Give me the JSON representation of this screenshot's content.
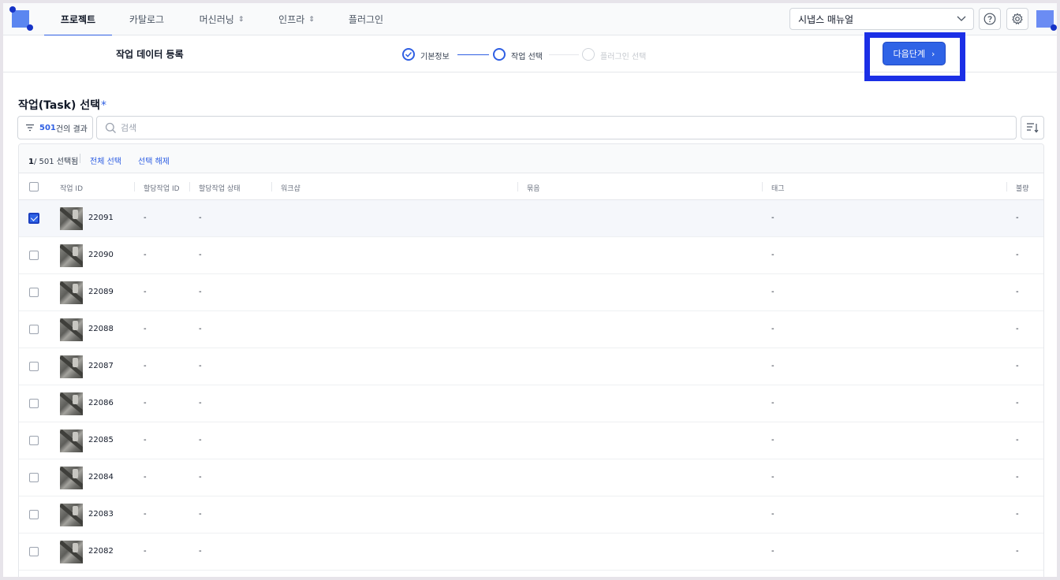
{
  "nav": {
    "tabs": [
      {
        "label": "프로젝트",
        "active": true,
        "dropdown": false
      },
      {
        "label": "카탈로그",
        "active": false,
        "dropdown": false
      },
      {
        "label": "머신러닝",
        "active": false,
        "dropdown": true
      },
      {
        "label": "인프라",
        "active": false,
        "dropdown": true
      },
      {
        "label": "플러그인",
        "active": false,
        "dropdown": false
      }
    ],
    "manual_select": "시냅스 매뉴얼",
    "help_icon": "question-circle-icon",
    "settings_icon": "gear-icon"
  },
  "header": {
    "title": "작업 데이터 등록",
    "steps": [
      {
        "label": "기본정보",
        "state": "done"
      },
      {
        "label": "작업 선택",
        "state": "current"
      },
      {
        "label": "플러그인 선택",
        "state": "disabled"
      }
    ],
    "next_button": "다음단계",
    "next_arrow": "›"
  },
  "section": {
    "title": "작업(Task) 선택",
    "required_mark": "*"
  },
  "filter": {
    "count": "501",
    "suffix": "건의 결과"
  },
  "search": {
    "placeholder": "검색",
    "value": ""
  },
  "selection": {
    "selected": "1",
    "total": "/ 501 선택됨",
    "select_all": "전체 선택",
    "deselect": "선택 해제"
  },
  "table": {
    "columns": [
      "작업 ID",
      "할당작업 ID",
      "할당작업 상태",
      "워크샵",
      "묶음",
      "태그",
      "불량"
    ],
    "rows": [
      {
        "id": "22091",
        "assign_id": "-",
        "assign_status": "-",
        "workshop": "",
        "bundle": "",
        "tag": "-",
        "defect": "-",
        "checked": true
      },
      {
        "id": "22090",
        "assign_id": "-",
        "assign_status": "-",
        "workshop": "",
        "bundle": "",
        "tag": "-",
        "defect": "-",
        "checked": false
      },
      {
        "id": "22089",
        "assign_id": "-",
        "assign_status": "-",
        "workshop": "",
        "bundle": "",
        "tag": "-",
        "defect": "-",
        "checked": false
      },
      {
        "id": "22088",
        "assign_id": "-",
        "assign_status": "-",
        "workshop": "",
        "bundle": "",
        "tag": "-",
        "defect": "-",
        "checked": false
      },
      {
        "id": "22087",
        "assign_id": "-",
        "assign_status": "-",
        "workshop": "",
        "bundle": "",
        "tag": "-",
        "defect": "-",
        "checked": false
      },
      {
        "id": "22086",
        "assign_id": "-",
        "assign_status": "-",
        "workshop": "",
        "bundle": "",
        "tag": "-",
        "defect": "-",
        "checked": false
      },
      {
        "id": "22085",
        "assign_id": "-",
        "assign_status": "-",
        "workshop": "",
        "bundle": "",
        "tag": "-",
        "defect": "-",
        "checked": false
      },
      {
        "id": "22084",
        "assign_id": "-",
        "assign_status": "-",
        "workshop": "",
        "bundle": "",
        "tag": "-",
        "defect": "-",
        "checked": false
      },
      {
        "id": "22083",
        "assign_id": "-",
        "assign_status": "-",
        "workshop": "",
        "bundle": "",
        "tag": "-",
        "defect": "-",
        "checked": false
      },
      {
        "id": "22082",
        "assign_id": "-",
        "assign_status": "-",
        "workshop": "",
        "bundle": "",
        "tag": "-",
        "defect": "-",
        "checked": false
      }
    ]
  },
  "colors": {
    "accent": "#2f63e6",
    "highlight": "#1b2fe6"
  }
}
